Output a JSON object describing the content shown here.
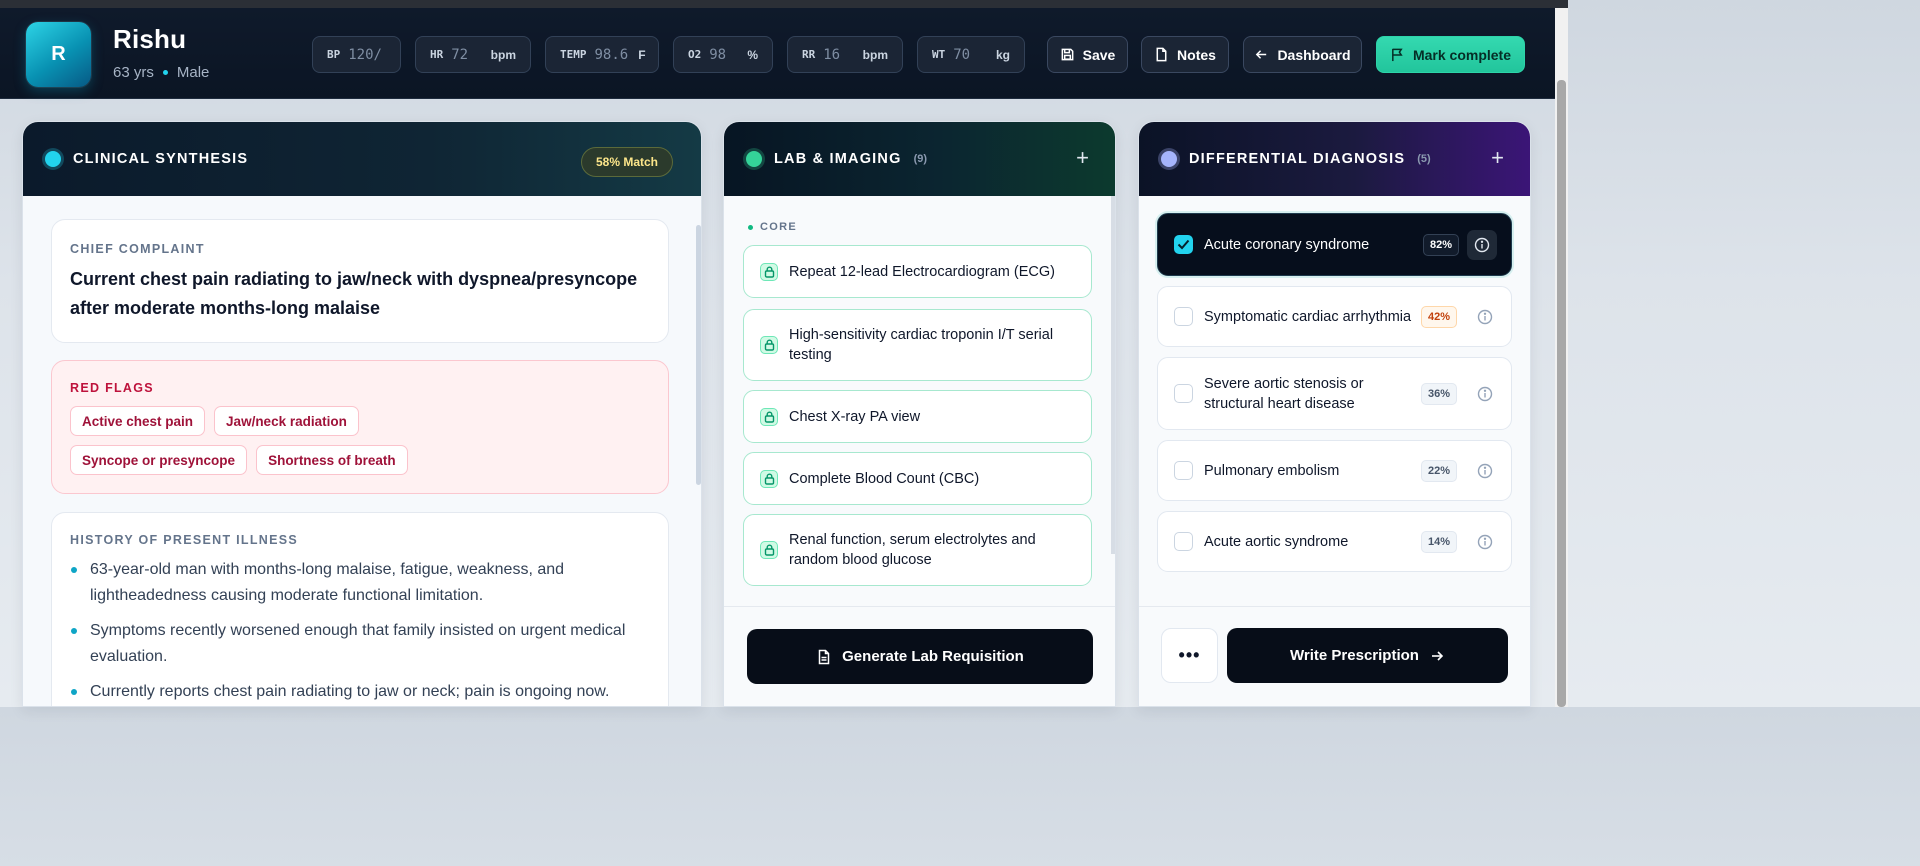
{
  "patient": {
    "initial": "R",
    "name": "Rishu",
    "age": "63 yrs",
    "sex": "Male"
  },
  "vitals": [
    {
      "label": "BP",
      "value": "120/",
      "unit": ""
    },
    {
      "label": "HR",
      "value": "72",
      "unit": "bpm"
    },
    {
      "label": "TEMP",
      "value": "98.6",
      "unit": "F"
    },
    {
      "label": "O2",
      "value": "98",
      "unit": "%"
    },
    {
      "label": "RR",
      "value": "16",
      "unit": "bpm"
    },
    {
      "label": "WT",
      "value": "70",
      "unit": "kg"
    }
  ],
  "actions": {
    "save": "Save",
    "notes": "Notes",
    "dashboard": "Dashboard",
    "complete": "Mark complete"
  },
  "synthesis": {
    "title": "CLINICAL SYNTHESIS",
    "match": "58% Match",
    "chief_label": "CHIEF COMPLAINT",
    "chief_text": "Current chest pain radiating to jaw/neck with dyspnea/presyncope after moderate months-long malaise",
    "red_flags_label": "RED FLAGS",
    "red_flags": [
      "Active chest pain",
      "Jaw/neck radiation",
      "Syncope or presyncope",
      "Shortness of breath"
    ],
    "hpi_label": "HISTORY OF PRESENT ILLNESS",
    "hpi": [
      "63-year-old man with months-long malaise, fatigue, weakness, and lightheadedness causing moderate functional limitation.",
      "Symptoms recently worsened enough that family insisted on urgent medical evaluation.",
      "Currently reports chest pain radiating to jaw or neck; pain is ongoing now."
    ]
  },
  "labs": {
    "title": "LAB & IMAGING",
    "count": "(9)",
    "section": "CORE",
    "items": [
      "Repeat 12-lead Electrocardiogram (ECG)",
      "High-sensitivity cardiac troponin I/T serial testing",
      "Chest X-ray PA view",
      "Complete Blood Count (CBC)",
      "Renal function, serum electrolytes and random blood glucose"
    ],
    "generate": "Generate Lab Requisition"
  },
  "differential": {
    "title": "DIFFERENTIAL DIAGNOSIS",
    "count": "(5)",
    "items": [
      {
        "name": "Acute coronary syndrome",
        "pct": "82%",
        "selected": true
      },
      {
        "name": "Symptomatic cardiac arrhythmia",
        "pct": "42%",
        "selected": false
      },
      {
        "name": "Severe aortic stenosis or structural heart disease",
        "pct": "36%",
        "selected": false
      },
      {
        "name": "Pulmonary embolism",
        "pct": "22%",
        "selected": false
      },
      {
        "name": "Acute aortic syndrome",
        "pct": "14%",
        "selected": false
      }
    ],
    "more": "•••",
    "prescribe": "Write Prescription"
  },
  "colors": {
    "accent": "#22d3ee",
    "complete": "#2dd4a9",
    "warning": "#c2410c"
  }
}
